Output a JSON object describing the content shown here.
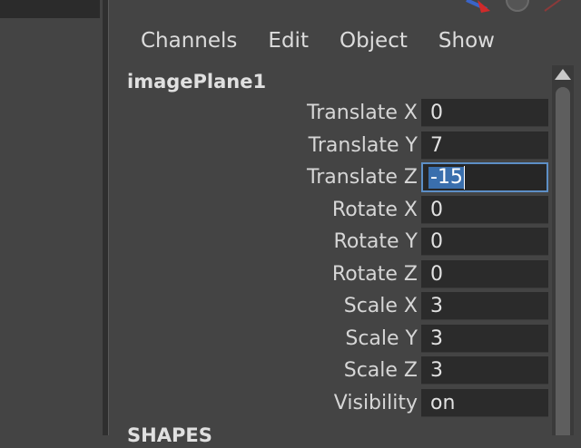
{
  "menu": {
    "items": [
      "Channels",
      "Edit",
      "Object",
      "Show"
    ]
  },
  "node": {
    "name": "imagePlane1"
  },
  "attributes": [
    {
      "label": "Translate X",
      "value": "0"
    },
    {
      "label": "Translate Y",
      "value": "7"
    },
    {
      "label": "Translate Z",
      "value": "-15"
    },
    {
      "label": "Rotate X",
      "value": "0"
    },
    {
      "label": "Rotate Y",
      "value": "0"
    },
    {
      "label": "Rotate Z",
      "value": "0"
    },
    {
      "label": "Scale X",
      "value": "3"
    },
    {
      "label": "Scale Y",
      "value": "3"
    },
    {
      "label": "Scale Z",
      "value": "3"
    },
    {
      "label": "Visibility",
      "value": "on"
    }
  ],
  "active_attribute_index": 2,
  "section": {
    "shapes_label": "SHAPES"
  },
  "icons": [
    "move-tool-icon",
    "sphere-icon",
    "scrollbar-up-arrow-icon"
  ],
  "colors": {
    "panel_bg": "#444444",
    "field_bg": "#2b2b2b",
    "active_border": "#5d8fc6",
    "selection": "#3a6fad",
    "text": "#d6d6d6"
  }
}
